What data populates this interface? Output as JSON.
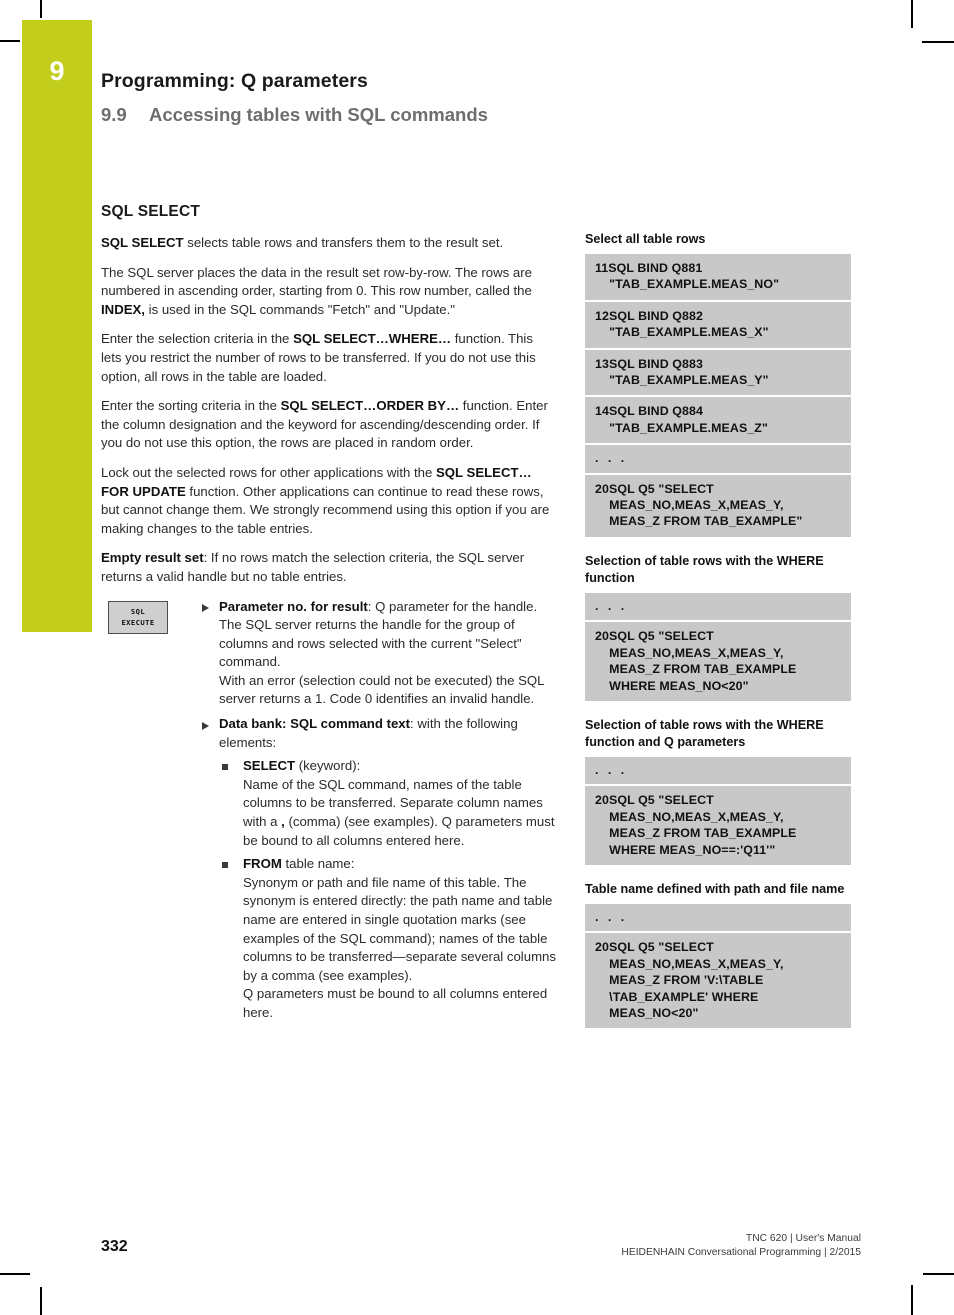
{
  "chapter": {
    "number": "9",
    "title": "Programming: Q parameters",
    "section_number": "9.9",
    "section_title": "Accessing tables with SQL commands",
    "accent_color": "#c3cd1c"
  },
  "main": {
    "heading": "SQL SELECT",
    "paragraphs": [
      {
        "id": "p1",
        "runs": [
          {
            "text": "SQL SELECT",
            "bold": true
          },
          {
            "text": " selects table rows and transfers them to the result set.",
            "bold": false
          }
        ]
      },
      {
        "id": "p2",
        "runs": [
          {
            "text": "The SQL server places the data in the result set row-by-row. The rows are numbered in ascending order, starting from 0. This row number, called the ",
            "bold": false
          },
          {
            "text": "INDEX,",
            "bold": true
          },
          {
            "text": " is used in the SQL commands \"Fetch\" and \"Update.\"",
            "bold": false
          }
        ]
      },
      {
        "id": "p3",
        "runs": [
          {
            "text": "Enter the selection criteria in the ",
            "bold": false
          },
          {
            "text": "SQL SELECT…WHERE…",
            "bold": true
          },
          {
            "text": " function. This lets you restrict the number of rows to be transferred. If you do not use this option, all rows in the table are loaded.",
            "bold": false
          }
        ]
      },
      {
        "id": "p4",
        "runs": [
          {
            "text": "Enter the sorting criteria in the ",
            "bold": false
          },
          {
            "text": "SQL SELECT…ORDER BY…",
            "bold": true
          },
          {
            "text": " function. Enter the column designation and the keyword for ascending/descending order. If you do not use this option, the rows are placed in random order.",
            "bold": false
          }
        ]
      },
      {
        "id": "p5",
        "runs": [
          {
            "text": "Lock out the selected rows for other applications with the ",
            "bold": false
          },
          {
            "text": "SQL SELECT…FOR UPDATE",
            "bold": true
          },
          {
            "text": " function. Other applications can continue to read these rows, but cannot change them. We strongly recommend using this option if you are making changes to the table entries.",
            "bold": false
          }
        ]
      },
      {
        "id": "p6",
        "runs": [
          {
            "text": "Empty result set",
            "bold": true
          },
          {
            "text": ": If no rows match the selection criteria, the SQL server returns a valid handle but no table entries.",
            "bold": false
          }
        ]
      }
    ],
    "softkey": {
      "line1": "SQL",
      "line2": "EXECUTE"
    },
    "bullets": [
      {
        "id": "b1",
        "runs": [
          {
            "text": "Parameter no. for result",
            "bold": true
          },
          {
            "text": ": Q parameter for the handle. The SQL server returns the handle for the group of columns and rows selected with the current \"Select\" command.\nWith an error (selection could not be executed) the SQL server returns a 1. Code 0 identifies an invalid handle.",
            "bold": false
          }
        ],
        "sub": []
      },
      {
        "id": "b2",
        "runs": [
          {
            "text": "Data bank: SQL command text",
            "bold": true
          },
          {
            "text": ": with the following elements:",
            "bold": false
          }
        ],
        "sub": [
          {
            "id": "s1",
            "runs": [
              {
                "text": "SELECT",
                "bold": true
              },
              {
                "text": " (keyword):\nName of the SQL command, names of the table columns to be transferred. Separate column names with a ",
                "bold": false
              },
              {
                "text": ",",
                "bold": true
              },
              {
                "text": " (comma) (see examples). Q parameters must be bound to all columns entered here.",
                "bold": false
              }
            ]
          },
          {
            "id": "s2",
            "runs": [
              {
                "text": "FROM",
                "bold": true
              },
              {
                "text": " table name:\nSynonym or path and file name of this table. The synonym is entered directly: the path name and table name are entered in single quotation marks (see examples of the SQL command); names of the table columns to be transferred—separate several columns by a comma (see examples).\nQ parameters must be bound to all columns entered here.",
                "bold": false
              }
            ]
          }
        ]
      }
    ]
  },
  "examples": [
    {
      "id": "ex1",
      "title": "Select all table rows",
      "rows": [
        "11SQL BIND Q881\n    \"TAB_EXAMPLE.MEAS_NO\"",
        "12SQL BIND Q882\n    \"TAB_EXAMPLE.MEAS_X\"",
        "13SQL BIND Q883\n    \"TAB_EXAMPLE.MEAS_Y\"",
        "14SQL BIND Q884\n    \"TAB_EXAMPLE.MEAS_Z\"",
        ". . .",
        "20SQL Q5 \"SELECT\n    MEAS_NO,MEAS_X,MEAS_Y,\n    MEAS_Z FROM TAB_EXAMPLE\""
      ]
    },
    {
      "id": "ex2",
      "title": "Selection of table rows with the WHERE function",
      "rows": [
        ". . .",
        "20SQL Q5 \"SELECT\n    MEAS_NO,MEAS_X,MEAS_Y,\n    MEAS_Z FROM TAB_EXAMPLE\n    WHERE MEAS_NO<20\""
      ]
    },
    {
      "id": "ex3",
      "title": "Selection of table rows with the WHERE function and Q parameters",
      "rows": [
        ". . .",
        "20SQL Q5 \"SELECT\n    MEAS_NO,MEAS_X,MEAS_Y,\n    MEAS_Z FROM TAB_EXAMPLE\n    WHERE MEAS_NO==:'Q11'\""
      ]
    },
    {
      "id": "ex4",
      "title": "Table name defined with path and file name",
      "rows": [
        ". . .",
        "20SQL Q5 \"SELECT\n    MEAS_NO,MEAS_X,MEAS_Y,\n    MEAS_Z FROM 'V:\\TABLE\n    \\TAB_EXAMPLE' WHERE\n    MEAS_NO<20\""
      ]
    }
  ],
  "footer": {
    "page_number": "332",
    "line1": "TNC 620 | User's Manual",
    "line2": "HEIDENHAIN Conversational Programming | 2/2015"
  }
}
